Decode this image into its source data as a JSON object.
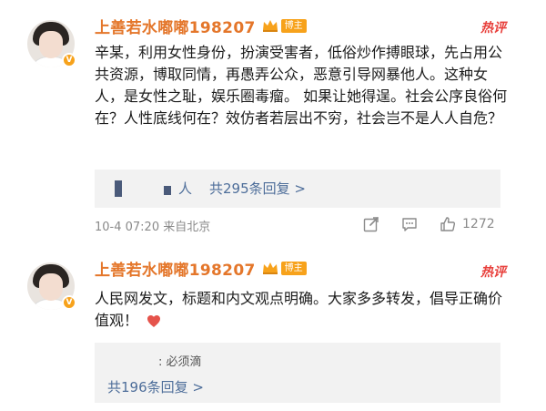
{
  "comments": [
    {
      "username": "上善若水嘟嘟198207",
      "badge": "博主",
      "hot_tag": "热评",
      "text": "辛某，利用女性身份，扮演受害者，低俗炒作搏眼球，先占用公共资源，博取同情，再愚弄公众，恶意引导网暴他人。这种女人，是女性之耻，娱乐圈毒瘤。 如果让她得逞。社会公序良俗何在？人性底线何在？效仿者若层出不穷，社会岂不是人人自危？",
      "reply_snippet": "人",
      "reply_count": "共295条回复 >",
      "timestamp": "10-4 07:20 来自北京",
      "like_count": "1272"
    },
    {
      "username": "上善若水嘟嘟198207",
      "badge": "博主",
      "hot_tag": "热评",
      "text": "人民网发文，标题和内文观点明确。大家多多转发，倡导正确价值观！",
      "reply_snippet": ": 必须滴",
      "reply_count": "共196条回复 >"
    }
  ],
  "icons": {
    "verified": "verified-v-icon",
    "crown": "crown-icon",
    "share": "share-icon",
    "comment": "comment-icon",
    "like": "thumbs-up-icon",
    "heart": "heart-icon"
  },
  "colors": {
    "username": "#e4762a",
    "badge": "#f7a21b",
    "hot": "#e8403c",
    "link": "#4e6e9a",
    "meta": "#8a8a8a",
    "heart": "#e5534b"
  }
}
